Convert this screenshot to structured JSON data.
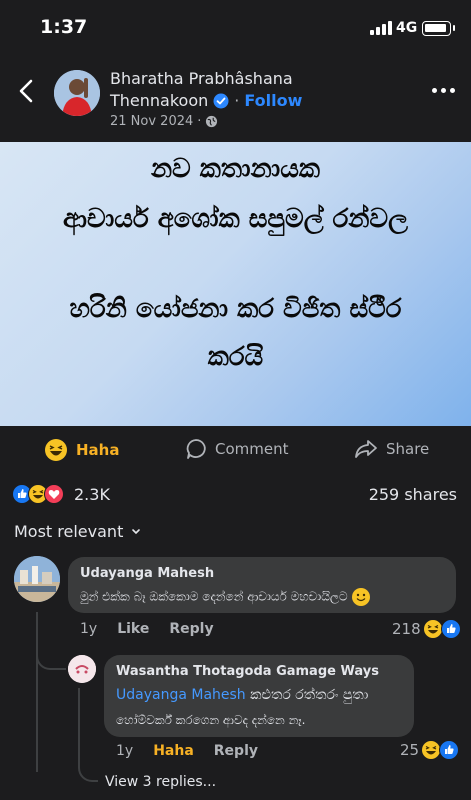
{
  "status_bar": {
    "time": "1:37",
    "network": "4G"
  },
  "post": {
    "author_line1": "Bharatha Prabhâshana",
    "author_line2": "Thennakoon",
    "follow_label": "Follow",
    "date": "21 Nov 2024",
    "separator": "·",
    "banner_lines": [
      "නව කතානායක",
      "ආචාර්ය අශෝක සපුමල් රන්වල",
      "හරිනි යෝජනා කර විජිත ස්ථීර",
      "කරයි"
    ]
  },
  "actions": {
    "reaction_label": "Haha",
    "comment_label": "Comment",
    "share_label": "Share"
  },
  "stats": {
    "reaction_count": "2.3K",
    "shares": "259 shares"
  },
  "sort_label": "Most relevant",
  "comments": [
    {
      "name": "Udayanga Mahesh",
      "text": "මුන් එක්ක බෑ ඔක්කොම  දෙන්නේ ආචාර්ය මහචායිලට",
      "time": "1y",
      "like_label": "Like",
      "reply_label": "Reply",
      "reaction_count": "218"
    }
  ],
  "reply": {
    "name": "Wasantha Thotagoda Gamage Ways",
    "mention": "Udayanga Mahesh",
    "text_line1": " කළුතර  රත්තරං පුතා",
    "text_line2": "හෝම්වර්ක් කරගෙන ආවද දන්නෙ නෑ.",
    "time": "1y",
    "reaction_label": "Haha",
    "reply_label": "Reply",
    "reaction_count": "25"
  },
  "view_replies_label": "View 3 replies...",
  "colors": {
    "accent": "#2d88ff",
    "haha": "#f7b125",
    "bubble": "#3a3b3c",
    "background": "#1c1c1e"
  }
}
